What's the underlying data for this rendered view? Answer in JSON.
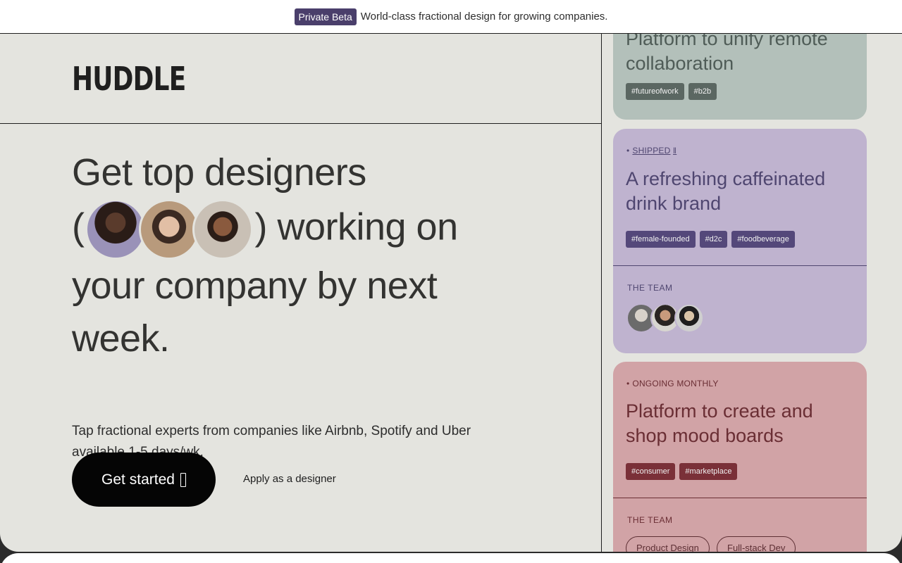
{
  "banner": {
    "badge": "Private Beta",
    "text": "World-class fractional design for growing companies."
  },
  "header": {
    "logo": "HUDDLE"
  },
  "hero": {
    "title_line1": "Get top designers",
    "title_open_paren": "(",
    "title_after_avatars": ") working on your company by next week.",
    "subtitle": "Tap fractional experts from companies like Airbnb, Spotify and Uber available 1-5 days/wk.",
    "cta_label": "Get started",
    "apply_label": "Apply as a designer"
  },
  "cards": [
    {
      "title": "Platform to unify remote collaboration",
      "tags": [
        "#futureofwork",
        "#b2b"
      ],
      "bg": "#b3c0ba",
      "text_color": "#4f5c57",
      "tag_bg": "#5b6762"
    },
    {
      "status": "SHIPPED",
      "status_link": "‖",
      "title": "A refreshing caffeinated drink brand",
      "tags": [
        "#female-founded",
        "#d2c",
        "#foodbeverage"
      ],
      "team_label": "THE TEAM",
      "bg": "#bfb3cf",
      "text_color": "#4f4670",
      "tag_bg": "#54487a"
    },
    {
      "status": "ONGOING MONTHLY",
      "title": "Platform to create and shop mood boards",
      "tags": [
        "#consumer",
        "#marketplace"
      ],
      "team_label": "THE TEAM",
      "roles": [
        "Product Design",
        "Full-stack Dev"
      ],
      "bg": "#d1a3a6",
      "text_color": "#6a2e34",
      "tag_bg": "#7a3038"
    }
  ],
  "colors": {
    "page_bg": "#e4e4df",
    "badge_bg": "#4a3f6b",
    "cta_bg": "#050505"
  }
}
